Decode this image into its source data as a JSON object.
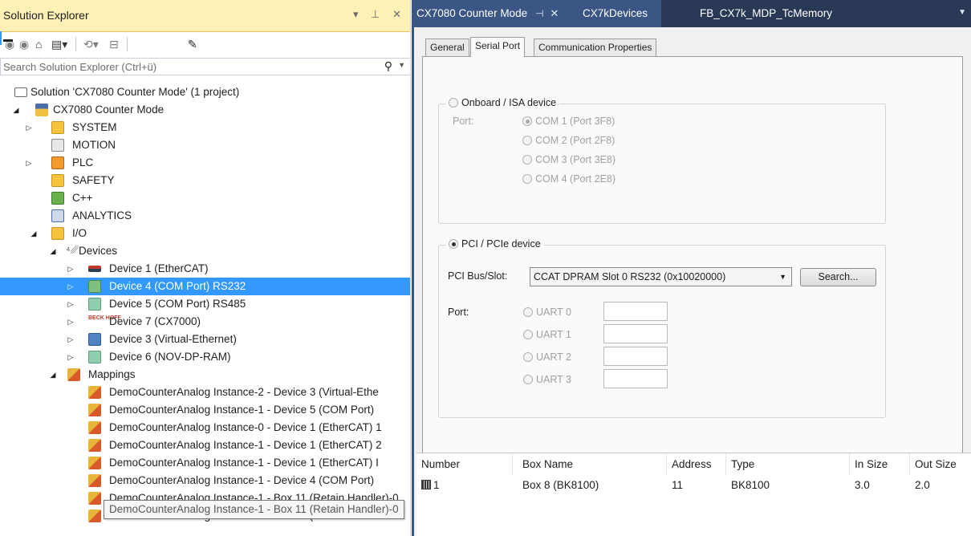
{
  "solution_explorer": {
    "title": "Solution Explorer",
    "title_controls": "▾ ⊥ ✕",
    "search_placeholder": "Search Solution Explorer (Ctrl+ü)",
    "tree": [
      {
        "label": "Solution 'CX7080 Counter Mode' (1 project)",
        "icon": "solution-icon"
      },
      {
        "label": "CX7080 Counter Mode",
        "icon": "project-icon"
      },
      {
        "label": "SYSTEM",
        "icon": "system-icon"
      },
      {
        "label": "MOTION",
        "icon": "motion-icon"
      },
      {
        "label": "PLC",
        "icon": "plc-icon"
      },
      {
        "label": "SAFETY",
        "icon": "safety-icon"
      },
      {
        "label": "C++",
        "icon": "cpp-icon"
      },
      {
        "label": "ANALYTICS",
        "icon": "analytics-icon"
      },
      {
        "label": "I/O",
        "icon": "io-icon"
      },
      {
        "label": "Devices",
        "icon": "devices-icon"
      },
      {
        "label": "Device 1 (EtherCAT)",
        "icon": "ethercat-icon"
      },
      {
        "label": "Device 4 (COM Port) RS232",
        "icon": "com-port-icon"
      },
      {
        "label": "Device 5 (COM Port) RS485",
        "icon": "com-port-icon"
      },
      {
        "label": "Device 7 (CX7000)",
        "icon": "beckhoff-icon",
        "badge": "BECK HOFF"
      },
      {
        "label": "Device 3 (Virtual-Ethernet)",
        "icon": "network-icon"
      },
      {
        "label": "Device 6 (NOV-DP-RAM)",
        "icon": "com-port-icon"
      },
      {
        "label": "Mappings",
        "icon": "mappings-icon"
      },
      {
        "label": "DemoCounterAnalog Instance-2 - Device 3 (Virtual-Ethe",
        "icon": "mapping-icon"
      },
      {
        "label": "DemoCounterAnalog Instance-1 - Device 5 (COM Port)",
        "icon": "mapping-icon"
      },
      {
        "label": "DemoCounterAnalog Instance-0 - Device 1 (EtherCAT) 1",
        "icon": "mapping-icon"
      },
      {
        "label": "DemoCounterAnalog Instance-1 - Device 1 (EtherCAT) 2",
        "icon": "mapping-icon"
      },
      {
        "label": "DemoCounterAnalog Instance-1 - Device 1 (EtherCAT) I",
        "icon": "mapping-icon"
      },
      {
        "label": "DemoCounterAnalog Instance-1 - Device 4 (COM Port)",
        "icon": "mapping-icon"
      },
      {
        "label": "DemoCounterAnalog Instance-1 - Box 11 (Retain Handler)-0",
        "icon": "mapping-icon"
      },
      {
        "label": "DemoCounterAnalog Instance-2 - Box 11 (Retain Handle",
        "icon": "mapping-icon"
      }
    ],
    "selected_index": 11,
    "tooltip": "DemoCounterAnalog Instance-1 - Box 11 (Retain Handler)-0"
  },
  "document": {
    "tabs": [
      {
        "label": "CX7080 Counter Mode",
        "active": true
      },
      {
        "label": "CX7kDevices",
        "active": false
      },
      {
        "label": "FB_CX7k_MDP_TcMemory",
        "active": false
      }
    ],
    "property_tabs": [
      {
        "label": "General",
        "active": false
      },
      {
        "label": "Serial Port",
        "active": true
      },
      {
        "label": "Communication Properties",
        "active": false
      }
    ],
    "onboard": {
      "legend": "Onboard / ISA device",
      "port_label": "Port:",
      "options": [
        "COM 1 (Port 3F8)",
        "COM 2 (Port 2F8)",
        "COM 3 (Port 3E8)",
        "COM 4 (Port 2E8)"
      ],
      "selected": 0
    },
    "pci": {
      "legend": "PCI / PCIe device",
      "bus_slot_label": "PCI Bus/Slot:",
      "bus_slot_value": "CCAT DPRAM Slot 0 RS232 (0x10020000)",
      "search_button": "Search...",
      "port_label": "Port:",
      "uarts": [
        "UART 0",
        "UART 1",
        "UART 2",
        "UART 3"
      ]
    },
    "list": {
      "columns": [
        "Number",
        "Box Name",
        "Address",
        "Type",
        "In Size",
        "Out Size"
      ],
      "rows": [
        {
          "number": "1",
          "box_name": "Box 8 (BK8100)",
          "address": "11",
          "type": "BK8100",
          "in_size": "3.0",
          "out_size": "2.0"
        }
      ]
    }
  },
  "colors": {
    "selection": "#3399ff",
    "title_bar": "#fff1b5",
    "doc_tab_bar": "#293955",
    "active_doc_tab": "#3b5584"
  }
}
